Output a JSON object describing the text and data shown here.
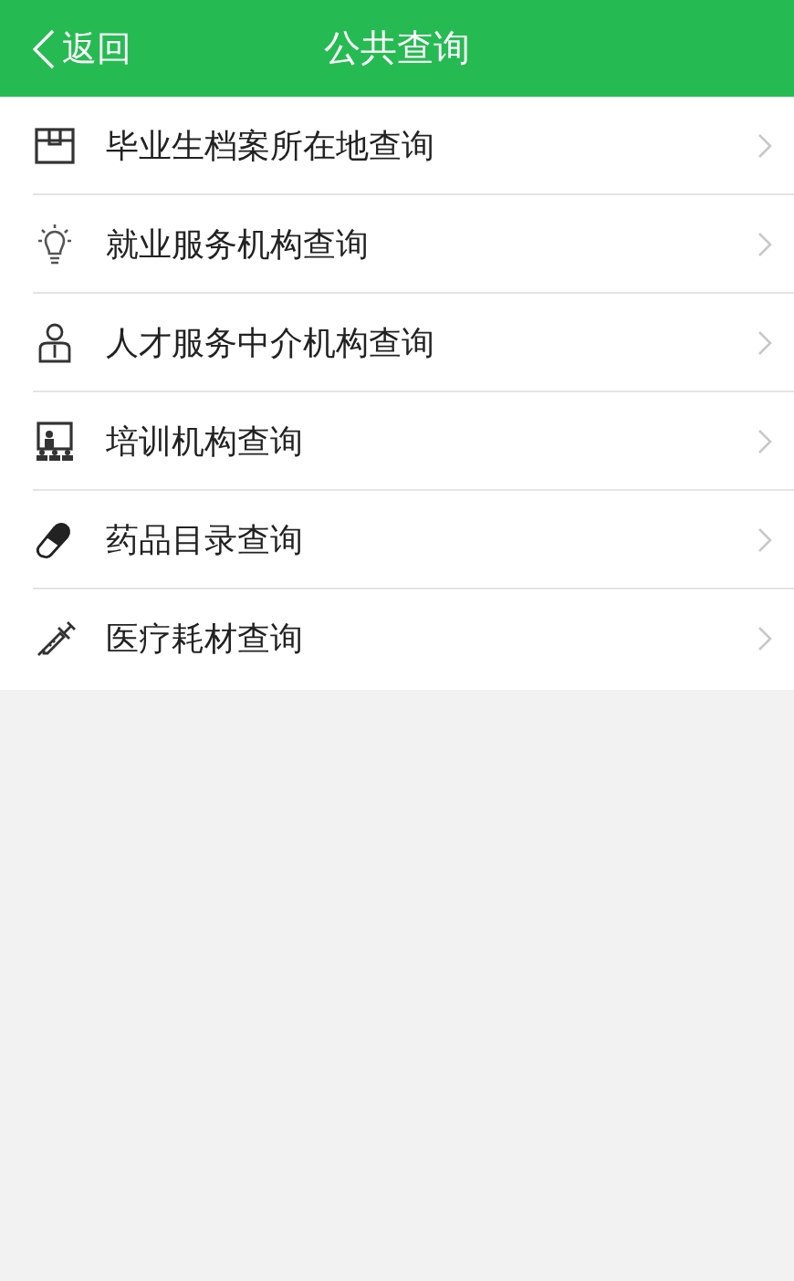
{
  "header": {
    "back": "返回",
    "title": "公共查询"
  },
  "items": [
    {
      "kind": "archive",
      "label": "毕业生档案所在地查询"
    },
    {
      "kind": "bulb",
      "label": "就业服务机构查询"
    },
    {
      "kind": "person",
      "label": "人才服务中介机构查询"
    },
    {
      "kind": "training",
      "label": "培训机构查询"
    },
    {
      "kind": "pill",
      "label": "药品目录查询"
    },
    {
      "kind": "syringe",
      "label": "医疗耗材查询"
    }
  ]
}
